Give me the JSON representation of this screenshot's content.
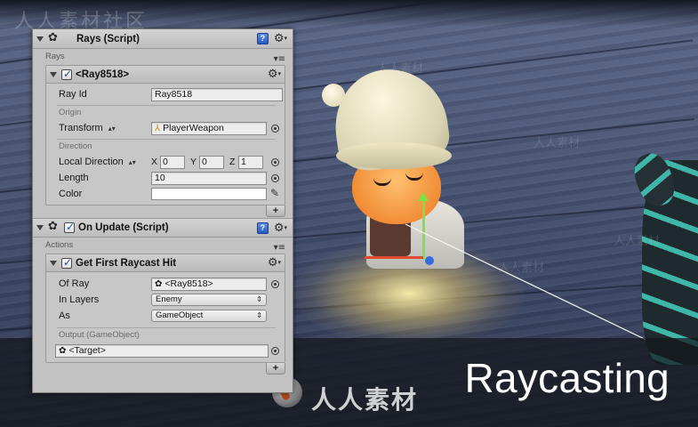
{
  "watermark": {
    "top_text": "人人素材社区",
    "brand_text": "人人素材",
    "side_marks": [
      "人人素材",
      "人人素材",
      "人人素材",
      "人人素材"
    ]
  },
  "caption": "Raycasting",
  "rays_component": {
    "title": "Rays (Script)",
    "section_label": "Rays",
    "ray_item": {
      "title": "<Ray8518>",
      "enabled": true,
      "ray_id_label": "Ray Id",
      "ray_id_value": "Ray8518",
      "origin_group": "Origin",
      "transform_label": "Transform",
      "transform_value": "PlayerWeapon",
      "direction_group": "Direction",
      "local_direction_label": "Local Direction",
      "vector": {
        "x_label": "X",
        "x": "0",
        "y_label": "Y",
        "y": "0",
        "z_label": "Z",
        "z": "1"
      },
      "length_label": "Length",
      "length_value": "10",
      "color_label": "Color",
      "color_value": "#ffffff"
    },
    "add_label": "+"
  },
  "onupdate_component": {
    "title": "On Update (Script)",
    "enabled": true,
    "section_label": "Actions",
    "action": {
      "title": "Get First Raycast Hit",
      "enabled": true,
      "of_ray_label": "Of Ray",
      "of_ray_value": "<Ray8518>",
      "in_layers_label": "In Layers",
      "in_layers_value": "Enemy",
      "as_label": "As",
      "as_value": "GameObject",
      "output_label": "Output (GameObject)",
      "output_value": "<Target>"
    },
    "add_label": "+"
  },
  "icons": {
    "help": "help-book-icon",
    "settings": "gear-dropdown-icon",
    "component": "script-component-icon",
    "transform": "transform-axes-icon",
    "picker": "object-picker-icon",
    "eyedropper": "eyedropper-icon",
    "list_menu": "list-menu-icon"
  },
  "colors": {
    "panel_bg": "#c2c2c2",
    "header_bg": "#bdbdbd",
    "field_bg": "#ececec",
    "help_blue": "#2a5ac0",
    "caption_band": "#141618"
  }
}
